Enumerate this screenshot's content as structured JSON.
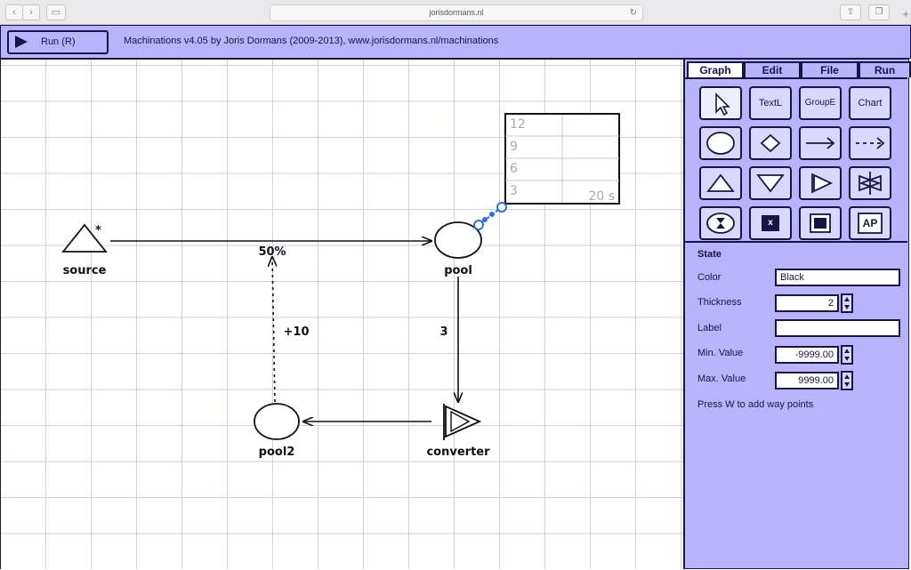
{
  "browser": {
    "url": "jorisdormans.nl"
  },
  "app": {
    "run_label": "Run (R)",
    "title": "Machinations v4.05 by Joris Dormans (2009-2013), www.jorisdormans.nl/machinations"
  },
  "panel": {
    "tabs": [
      "Graph",
      "Edit",
      "File",
      "Run"
    ],
    "tools": {
      "text": "TextL",
      "group": "GroupE",
      "chart": "Chart",
      "ap": "AP",
      "end": "x"
    },
    "state": {
      "title": "State",
      "color_label": "Color",
      "color_value": "Black",
      "thickness_label": "Thickness",
      "thickness_value": "2",
      "label_label": "Label",
      "label_value": "",
      "min_label": "Min. Value",
      "min_value": "-9999.00",
      "max_label": "Max. Value",
      "max_value": "9999.00",
      "hint": "Press W to add way points"
    }
  },
  "diagram": {
    "nodes": {
      "source": "source",
      "source_mark": "*",
      "pool": "pool",
      "pool2": "pool2",
      "converter": "converter"
    },
    "edges": {
      "source_to_pool": "50%",
      "pool2_to_pool_modifier": "+10",
      "pool_to_converter": "3"
    },
    "chart": {
      "y_labels": [
        "12",
        "9",
        "6",
        "3"
      ],
      "time_label": "20 s"
    }
  },
  "colors": {
    "accent": "#b8b4fb",
    "ink": "#1a1446",
    "grid": "#cfcce6",
    "selection": "#2a6ef0"
  }
}
